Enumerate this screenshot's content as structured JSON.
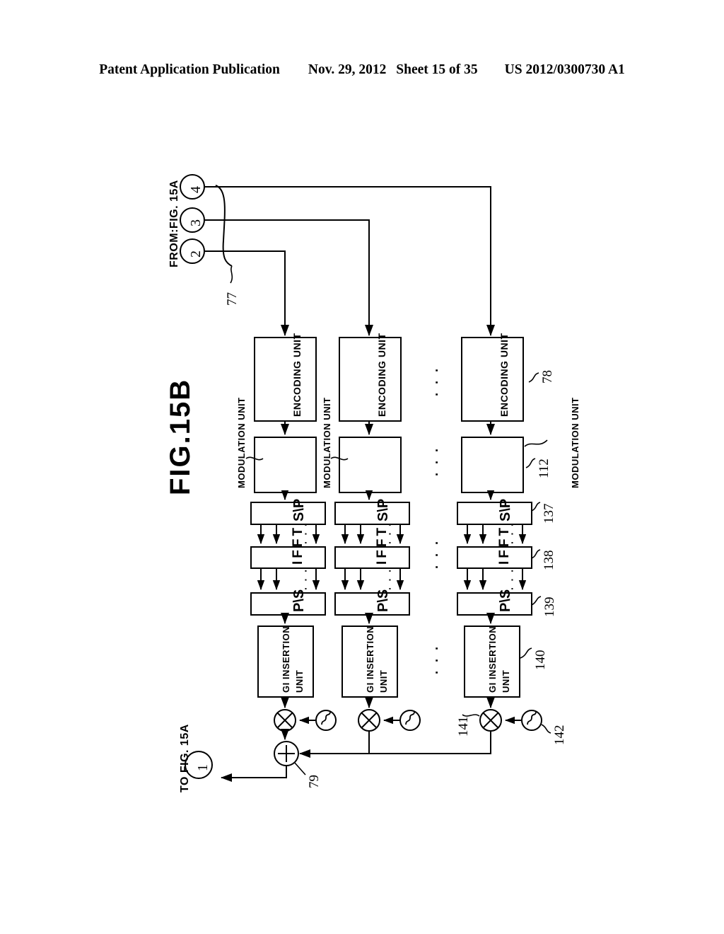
{
  "header": {
    "publication": "Patent Application Publication",
    "date": "Nov. 29, 2012",
    "sheet": "Sheet 15 of 35",
    "docnum": "US 2012/0300730 A1"
  },
  "figure": {
    "title": "FIG.15B",
    "from_label": "FROM:FIG. 15A",
    "to_label": "TO FIG. 15A",
    "input_ports": [
      {
        "id": "port-4",
        "label": "4"
      },
      {
        "id": "port-3",
        "label": "3"
      },
      {
        "id": "port-2",
        "label": "2"
      }
    ],
    "output_port": {
      "id": "port-1",
      "label": "1"
    },
    "ellipsis": "· · ·",
    "columns": [
      {
        "name": "branch-1",
        "encoding_label": "ENCODING UNIT",
        "modulation_outer_label": "MODULATION UNIT",
        "sp_label": "S\\P",
        "ifft_label": "IFFT",
        "ps_label": "P\\S",
        "gi_label_line1": "GI INSERTION",
        "gi_label_line2": "UNIT"
      },
      {
        "name": "branch-2",
        "encoding_label": "ENCODING UNIT",
        "modulation_outer_label": "MODULATION UNIT",
        "sp_label": "S\\P",
        "ifft_label": "IFFT",
        "ps_label": "P\\S",
        "gi_label_line1": "GI INSERTION",
        "gi_label_line2": "UNIT"
      },
      {
        "name": "branch-n",
        "encoding_label": "ENCODING UNIT",
        "modulation_outer_label": "MODULATION UNIT",
        "sp_label": "S\\P",
        "ifft_label": "IFFT",
        "ps_label": "P\\S",
        "gi_label_line1": "GI INSERTION",
        "gi_label_line2": "UNIT"
      }
    ],
    "reference_numerals": [
      {
        "name": "ref-77",
        "label": "77",
        "points_to": "input-port-bus"
      },
      {
        "name": "ref-78",
        "label": "78",
        "points_to": "encoding-unit"
      },
      {
        "name": "ref-112",
        "label": "112",
        "points_to": "modulation-unit"
      },
      {
        "name": "ref-137",
        "label": "137",
        "points_to": "serial-to-parallel"
      },
      {
        "name": "ref-138",
        "label": "138",
        "points_to": "ifft"
      },
      {
        "name": "ref-139",
        "label": "139",
        "points_to": "parallel-to-serial"
      },
      {
        "name": "ref-140",
        "label": "140",
        "points_to": "gi-insertion-unit"
      },
      {
        "name": "ref-141",
        "label": "141",
        "points_to": "mixer"
      },
      {
        "name": "ref-142",
        "label": "142",
        "points_to": "local-oscillator"
      },
      {
        "name": "ref-79",
        "label": "79",
        "points_to": "adder"
      }
    ],
    "symbols": {
      "mixer": "×",
      "adder": "+",
      "oscillator": "sine-wave"
    }
  }
}
